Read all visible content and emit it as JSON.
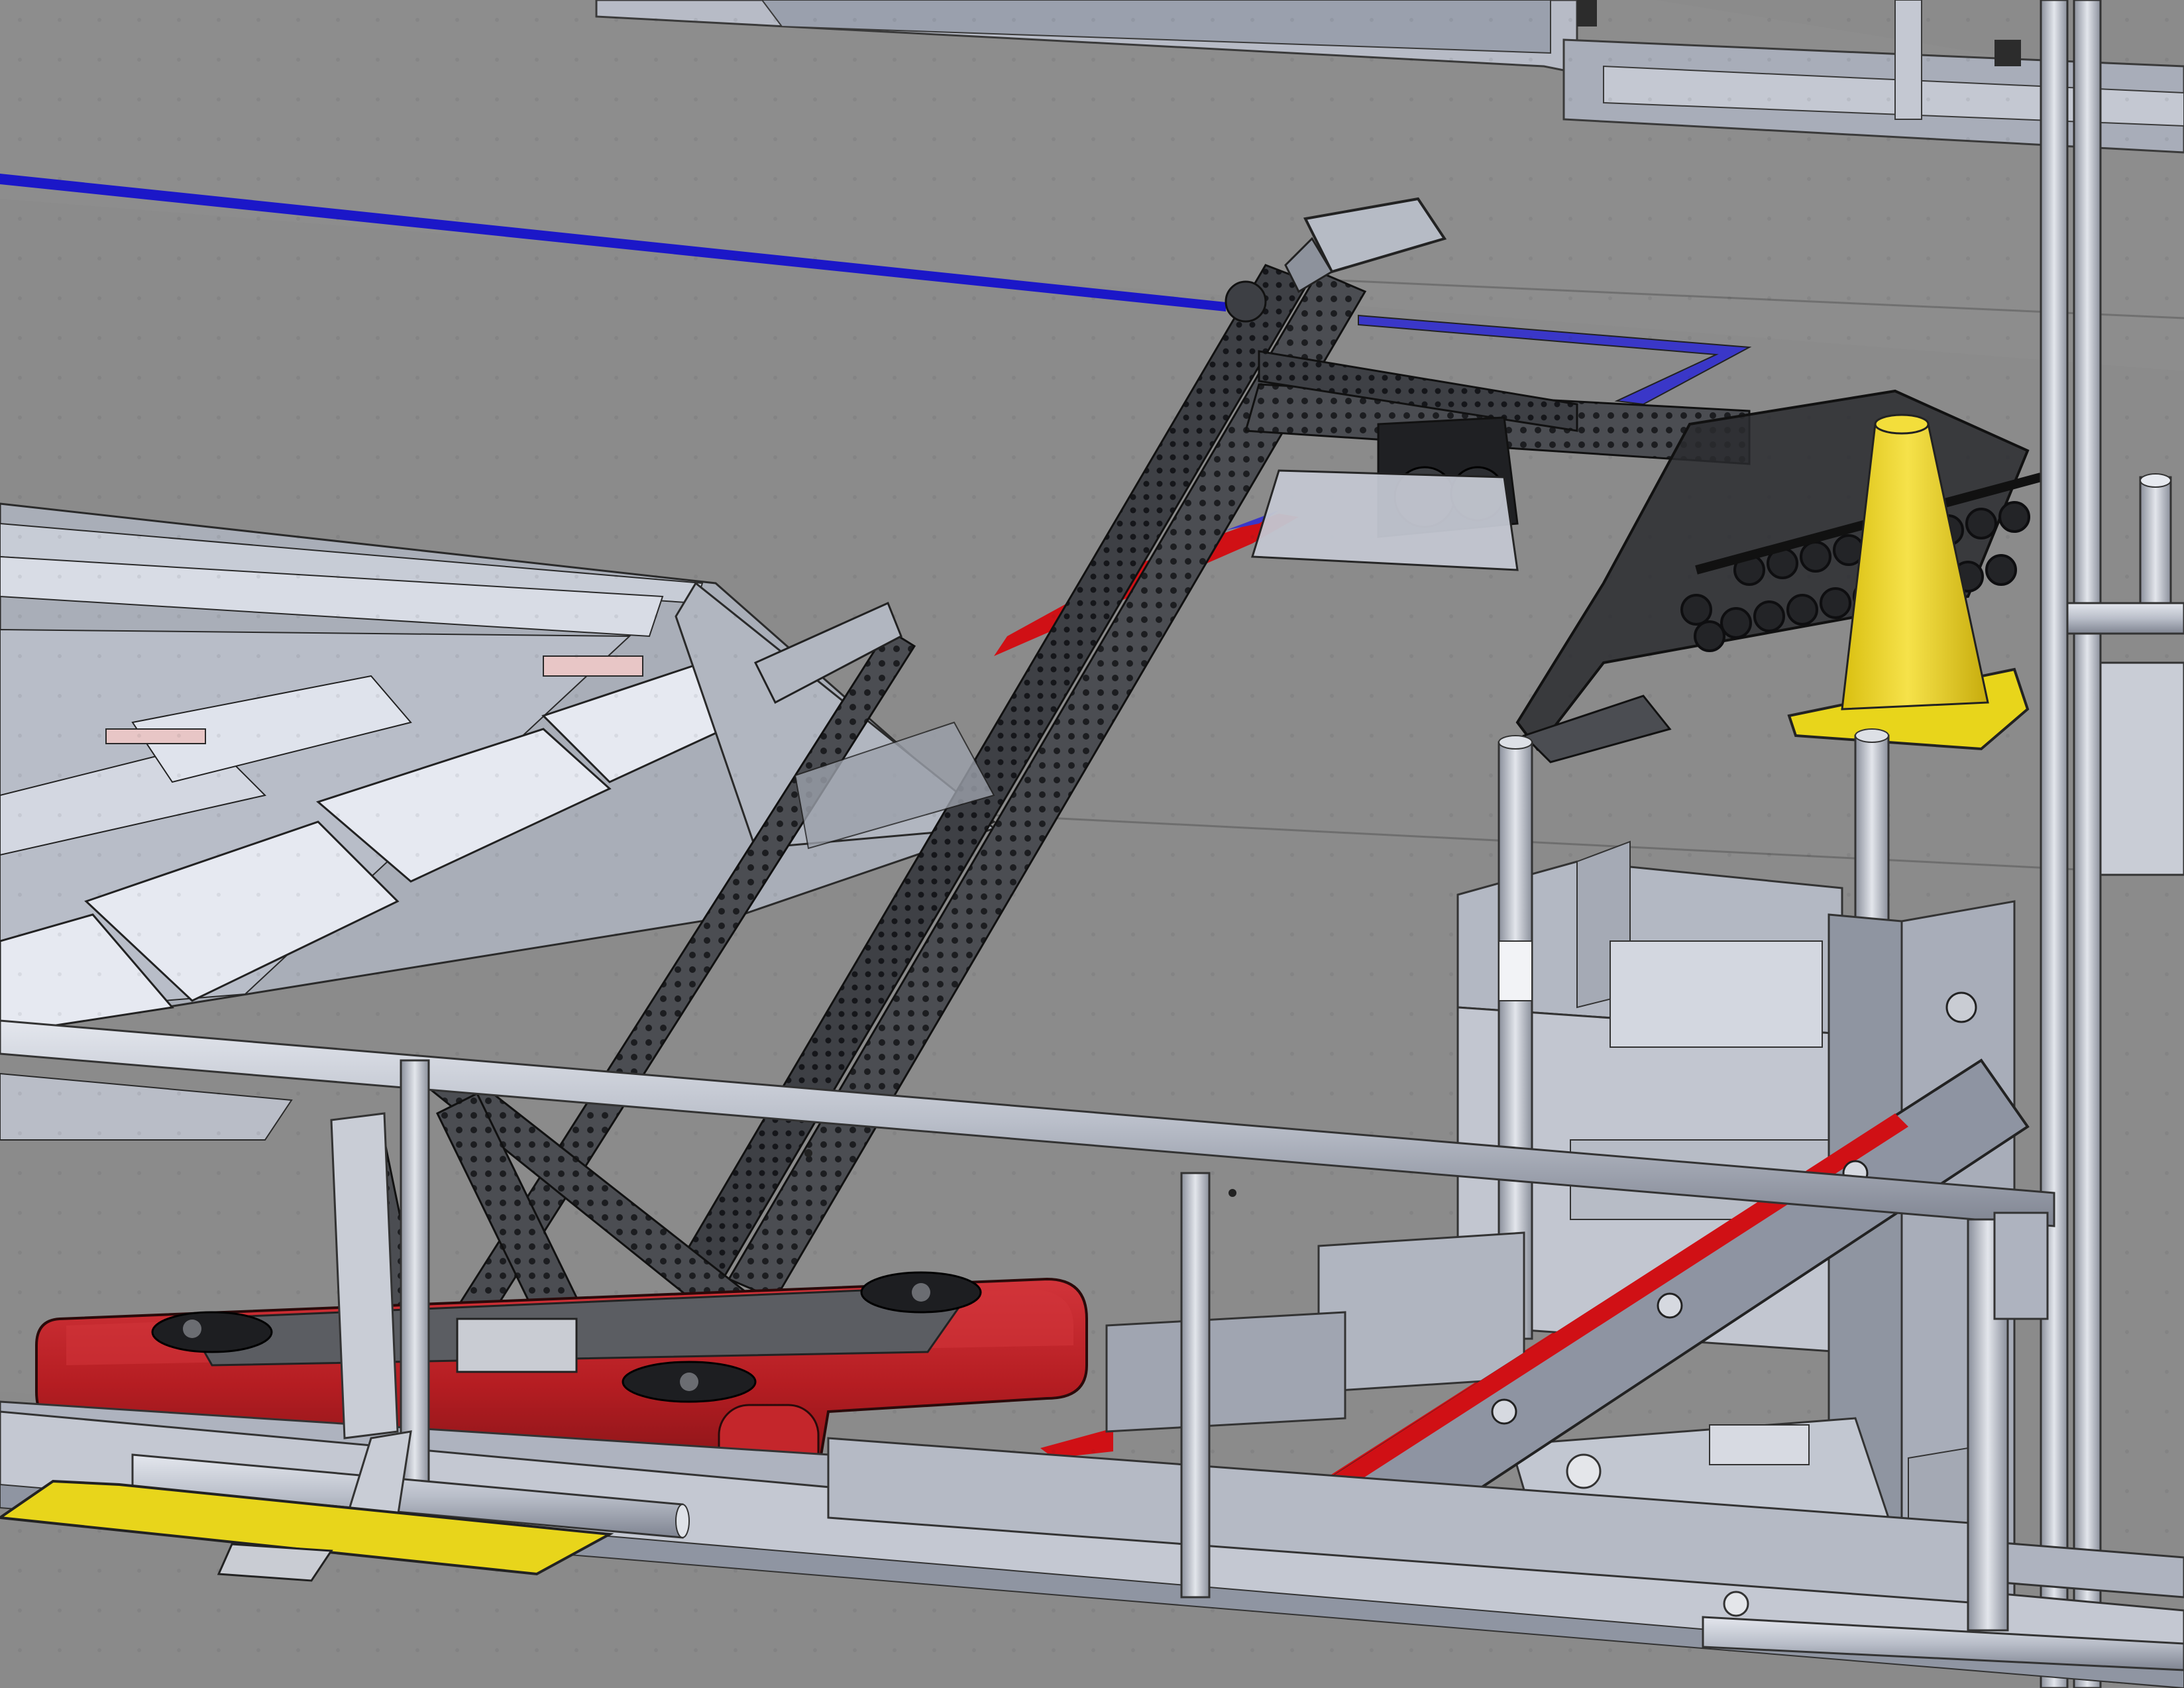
{
  "scene": {
    "colors": {
      "floor": "#8a8a8a",
      "floor_far": "#8c8c8c",
      "steel_light": "#c4c8d2",
      "steel_mid": "#a8adb9",
      "steel_dark": "#6f7480",
      "extrusion": "#4b4d52",
      "bumper_red": "#b51d22",
      "tape_red": "#d01015",
      "tape_blue": "#1b17c8",
      "cone_yellow": "#f0d81a",
      "yellow_plate": "#e8d51b",
      "panel_white": "#dfe3ee"
    },
    "icons": [
      "perforated-arm-icon",
      "bumper-frame-icon",
      "traffic-cone-icon",
      "guard-rail-icon",
      "roller-intake-icon"
    ]
  }
}
